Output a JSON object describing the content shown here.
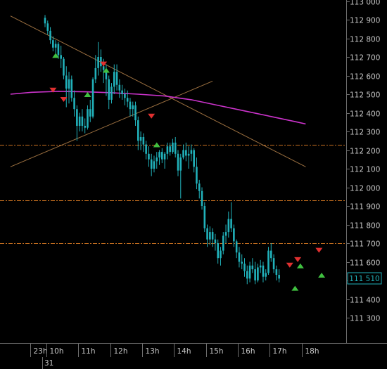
{
  "chart_data": {
    "type": "candlestick",
    "y_ticks": [
      {
        "value": 113000,
        "label": "113 000"
      },
      {
        "value": 112900,
        "label": "112 900"
      },
      {
        "value": 112800,
        "label": "112 800"
      },
      {
        "value": 112700,
        "label": "112 700"
      },
      {
        "value": 112600,
        "label": "112 600"
      },
      {
        "value": 112500,
        "label": "112 500"
      },
      {
        "value": 112400,
        "label": "112 400"
      },
      {
        "value": 112300,
        "label": "112 300"
      },
      {
        "value": 112200,
        "label": "112 200"
      },
      {
        "value": 112100,
        "label": "112 100"
      },
      {
        "value": 112000,
        "label": "112 000"
      },
      {
        "value": 111900,
        "label": "111 900"
      },
      {
        "value": 111800,
        "label": "111 800"
      },
      {
        "value": 111700,
        "label": "111 700"
      },
      {
        "value": 111600,
        "label": "111 600"
      },
      {
        "value": 111500,
        "label": "111 500"
      },
      {
        "value": 111400,
        "label": "111 400"
      },
      {
        "value": 111300,
        "label": "111 300"
      }
    ],
    "x_ticks": [
      {
        "bar": -5.5,
        "label": "23h"
      },
      {
        "bar": 0.5,
        "label": "10h"
      },
      {
        "bar": 12.5,
        "label": "11h"
      },
      {
        "bar": 24.5,
        "label": "12h"
      },
      {
        "bar": 36.5,
        "label": "13h"
      },
      {
        "bar": 48.5,
        "label": "14h"
      },
      {
        "bar": 60.5,
        "label": "15h"
      },
      {
        "bar": 72.5,
        "label": "16h"
      },
      {
        "bar": 84.5,
        "label": "17h"
      },
      {
        "bar": 96.5,
        "label": "18h"
      }
    ],
    "date_label": "31",
    "last_price": {
      "value": 111510,
      "label": "111 510"
    },
    "ohlc": [
      [
        112910,
        112925,
        112860,
        112880
      ],
      [
        112880,
        112895,
        112820,
        112840
      ],
      [
        112840,
        112860,
        112770,
        112790
      ],
      [
        112790,
        112810,
        112730,
        112750
      ],
      [
        112750,
        112790,
        112720,
        112770
      ],
      [
        112770,
        112780,
        112690,
        112710
      ],
      [
        112710,
        112760,
        112640,
        112690
      ],
      [
        112690,
        112700,
        112580,
        112600
      ],
      [
        112600,
        112650,
        112430,
        112530
      ],
      [
        112530,
        112620,
        112450,
        112580
      ],
      [
        112580,
        112600,
        112460,
        112480
      ],
      [
        112480,
        112520,
        112380,
        112420
      ],
      [
        112420,
        112440,
        112250,
        112330
      ],
      [
        112330,
        112400,
        112300,
        112380
      ],
      [
        112380,
        112420,
        112300,
        112330
      ],
      [
        112330,
        112370,
        112290,
        112320
      ],
      [
        112320,
        112440,
        112310,
        112420
      ],
      [
        112420,
        112470,
        112350,
        112380
      ],
      [
        112380,
        112590,
        112370,
        112580
      ],
      [
        112580,
        112710,
        112560,
        112640
      ],
      [
        112640,
        112780,
        112600,
        112700
      ],
      [
        112700,
        112740,
        112620,
        112650
      ],
      [
        112650,
        112690,
        112560,
        112630
      ],
      [
        112630,
        112660,
        112490,
        112580
      ],
      [
        112580,
        112600,
        112420,
        112470
      ],
      [
        112470,
        112560,
        112450,
        112540
      ],
      [
        112540,
        112660,
        112500,
        112620
      ],
      [
        112620,
        112660,
        112520,
        112550
      ],
      [
        112550,
        112580,
        112480,
        112520
      ],
      [
        112520,
        112550,
        112470,
        112500
      ],
      [
        112500,
        112530,
        112440,
        112480
      ],
      [
        112480,
        112520,
        112430,
        112460
      ],
      [
        112460,
        112480,
        112380,
        112420
      ],
      [
        112420,
        112460,
        112380,
        112440
      ],
      [
        112440,
        112460,
        112330,
        112360
      ],
      [
        112360,
        112380,
        112200,
        112250
      ],
      [
        112250,
        112300,
        112200,
        112270
      ],
      [
        112270,
        112290,
        112190,
        112230
      ],
      [
        112230,
        112250,
        112150,
        112180
      ],
      [
        112180,
        112220,
        112110,
        112150
      ],
      [
        112150,
        112180,
        112060,
        112100
      ],
      [
        112100,
        112170,
        112080,
        112140
      ],
      [
        112140,
        112190,
        112100,
        112160
      ],
      [
        112160,
        112200,
        112120,
        112190
      ],
      [
        112190,
        112210,
        112130,
        112150
      ],
      [
        112150,
        112190,
        112100,
        112180
      ],
      [
        112180,
        112240,
        112150,
        112220
      ],
      [
        112220,
        112240,
        112170,
        112190
      ],
      [
        112190,
        112260,
        112180,
        112240
      ],
      [
        112240,
        112270,
        112160,
        112180
      ],
      [
        112180,
        112200,
        112060,
        112090
      ],
      [
        112090,
        112180,
        111940,
        112160
      ],
      [
        112160,
        112230,
        112150,
        112200
      ],
      [
        112200,
        112240,
        112140,
        112170
      ],
      [
        112170,
        112220,
        112100,
        112180
      ],
      [
        112180,
        112230,
        112140,
        112200
      ],
      [
        112200,
        112210,
        112080,
        112110
      ],
      [
        112110,
        112160,
        111990,
        112020
      ],
      [
        112020,
        112040,
        111940,
        111980
      ],
      [
        111980,
        112000,
        111880,
        111900
      ],
      [
        111900,
        111920,
        111760,
        111780
      ],
      [
        111780,
        111800,
        111680,
        111720
      ],
      [
        111720,
        111790,
        111690,
        111760
      ],
      [
        111760,
        111780,
        111680,
        111720
      ],
      [
        111720,
        111750,
        111660,
        111700
      ],
      [
        111700,
        111720,
        111590,
        111620
      ],
      [
        111620,
        111680,
        111580,
        111660
      ],
      [
        111660,
        111760,
        111640,
        111740
      ],
      [
        111740,
        111800,
        111700,
        111760
      ],
      [
        111760,
        111870,
        111730,
        111830
      ],
      [
        111830,
        111920,
        111760,
        111780
      ],
      [
        111780,
        111800,
        111680,
        111710
      ],
      [
        111710,
        111720,
        111620,
        111650
      ],
      [
        111650,
        111680,
        111570,
        111600
      ],
      [
        111600,
        111640,
        111560,
        111590
      ],
      [
        111590,
        111620,
        111520,
        111550
      ],
      [
        111550,
        111580,
        111480,
        111510
      ],
      [
        111510,
        111600,
        111490,
        111580
      ],
      [
        111580,
        111620,
        111540,
        111560
      ],
      [
        111560,
        111600,
        111480,
        111500
      ],
      [
        111500,
        111590,
        111490,
        111570
      ],
      [
        111570,
        111610,
        111540,
        111580
      ],
      [
        111580,
        111600,
        111490,
        111520
      ],
      [
        111520,
        111560,
        111500,
        111540
      ],
      [
        111540,
        111680,
        111530,
        111660
      ],
      [
        111660,
        111700,
        111600,
        111620
      ],
      [
        111620,
        111640,
        111540,
        111560
      ],
      [
        111560,
        111580,
        111500,
        111530
      ],
      [
        111530,
        111560,
        111490,
        111510
      ]
    ],
    "moving_average": [
      {
        "bar": -13,
        "value": 112500
      },
      {
        "bar": -5,
        "value": 112510
      },
      {
        "bar": 5,
        "value": 112515
      },
      {
        "bar": 15,
        "value": 112513
      },
      {
        "bar": 25,
        "value": 112508
      },
      {
        "bar": 35,
        "value": 112500
      },
      {
        "bar": 45,
        "value": 112490
      },
      {
        "bar": 55,
        "value": 112470
      },
      {
        "bar": 65,
        "value": 112440
      },
      {
        "bar": 75,
        "value": 112410
      },
      {
        "bar": 85,
        "value": 112380
      },
      {
        "bar": 95,
        "value": 112350
      },
      {
        "bar": 98,
        "value": 112340
      }
    ],
    "colors": {
      "background": "#000000",
      "candle": "#21b1ba",
      "moving_average": "#cc33cc",
      "trendline": "#9c7040",
      "hline": "#c87020",
      "sell_marker": "#e03030",
      "buy_marker": "#40c040",
      "axis_text": "#c8c8c8",
      "axis_line": "#6e6e6e",
      "price_box_fill": "#000000",
      "price_box_border": "#21b1ba"
    },
    "hlines": [
      112230,
      111930,
      111700
    ],
    "trendlines": [
      {
        "from": {
          "bar": -13,
          "value": 112920
        },
        "to": {
          "bar": 98,
          "value": 112110
        }
      },
      {
        "from": {
          "bar": -13,
          "value": 112110
        },
        "to": {
          "bar": 63,
          "value": 112570
        }
      }
    ],
    "signals": [
      {
        "bar": 4,
        "type": "buy",
        "price": 112710
      },
      {
        "bar": 3,
        "type": "sell",
        "price": 112520
      },
      {
        "bar": 7,
        "type": "sell",
        "price": 112470
      },
      {
        "bar": 16,
        "type": "buy",
        "price": 112500
      },
      {
        "bar": 22,
        "type": "sell",
        "price": 112660
      },
      {
        "bar": 23,
        "type": "buy",
        "price": 112630
      },
      {
        "bar": 40,
        "type": "sell",
        "price": 112380
      },
      {
        "bar": 42,
        "type": "buy",
        "price": 112230
      },
      {
        "bar": 92,
        "type": "sell",
        "price": 111580
      },
      {
        "bar": 94,
        "type": "buy",
        "price": 111460
      },
      {
        "bar": 95,
        "type": "sell",
        "price": 111610
      },
      {
        "bar": 96,
        "type": "buy",
        "price": 111580
      },
      {
        "bar": 103,
        "type": "sell",
        "price": 111660
      },
      {
        "bar": 104,
        "type": "buy",
        "price": 111530
      }
    ]
  }
}
